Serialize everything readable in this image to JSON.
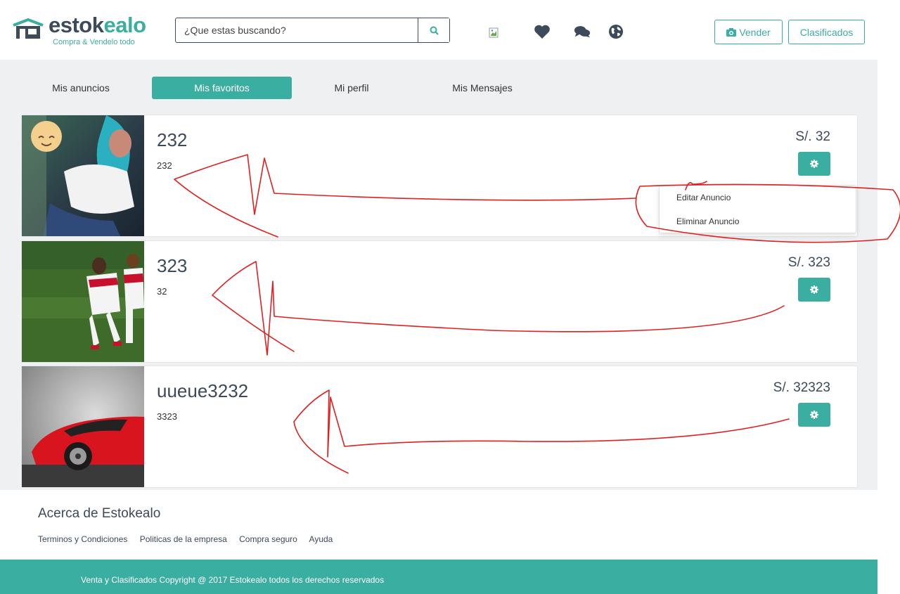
{
  "brand": {
    "name_prefix": "estok",
    "name_suffix": "ealo",
    "tagline": "Compra & Vendelo todo",
    "colors": {
      "primary": "#3aaea1",
      "dark": "#3c4a5a",
      "annotation": "#e02020"
    }
  },
  "search": {
    "placeholder": "¿Que estas buscando?",
    "icon": "search-icon"
  },
  "header_icons": [
    "broken-image-icon",
    "heart-icon",
    "comments-icon",
    "globe-icon"
  ],
  "header_buttons": {
    "sell": "Vender",
    "sell_icon": "camera-icon",
    "classifieds": "Clasificados"
  },
  "tabs": [
    {
      "label": "Mis anuncios",
      "active": false
    },
    {
      "label": "Mis favoritos",
      "active": true
    },
    {
      "label": "Mi perfil",
      "active": false
    },
    {
      "label": "Mis Mensajes",
      "active": false
    }
  ],
  "listings": [
    {
      "title": "232",
      "description": "232",
      "price": "S/. 32",
      "image": "girl-photo"
    },
    {
      "title": "323",
      "description": "32",
      "price": "S/. 323",
      "image": "soccer-players-photo"
    },
    {
      "title": "uueue3232",
      "description": "3323",
      "price": "S/. 32323",
      "image": "red-sports-car-photo"
    }
  ],
  "dropdown": {
    "edit": "Editar Anuncio",
    "delete": "Eliminar Anuncio"
  },
  "footer": {
    "about_title": "Acerca de Estokealo",
    "links": [
      "Terminos y Condiciones",
      "Politicas de la empresa",
      "Compra seguro",
      "Ayuda"
    ],
    "copyright": "Venta y Clasificados Copyright @ 2017 Estokealo todos los derechos reservados"
  }
}
